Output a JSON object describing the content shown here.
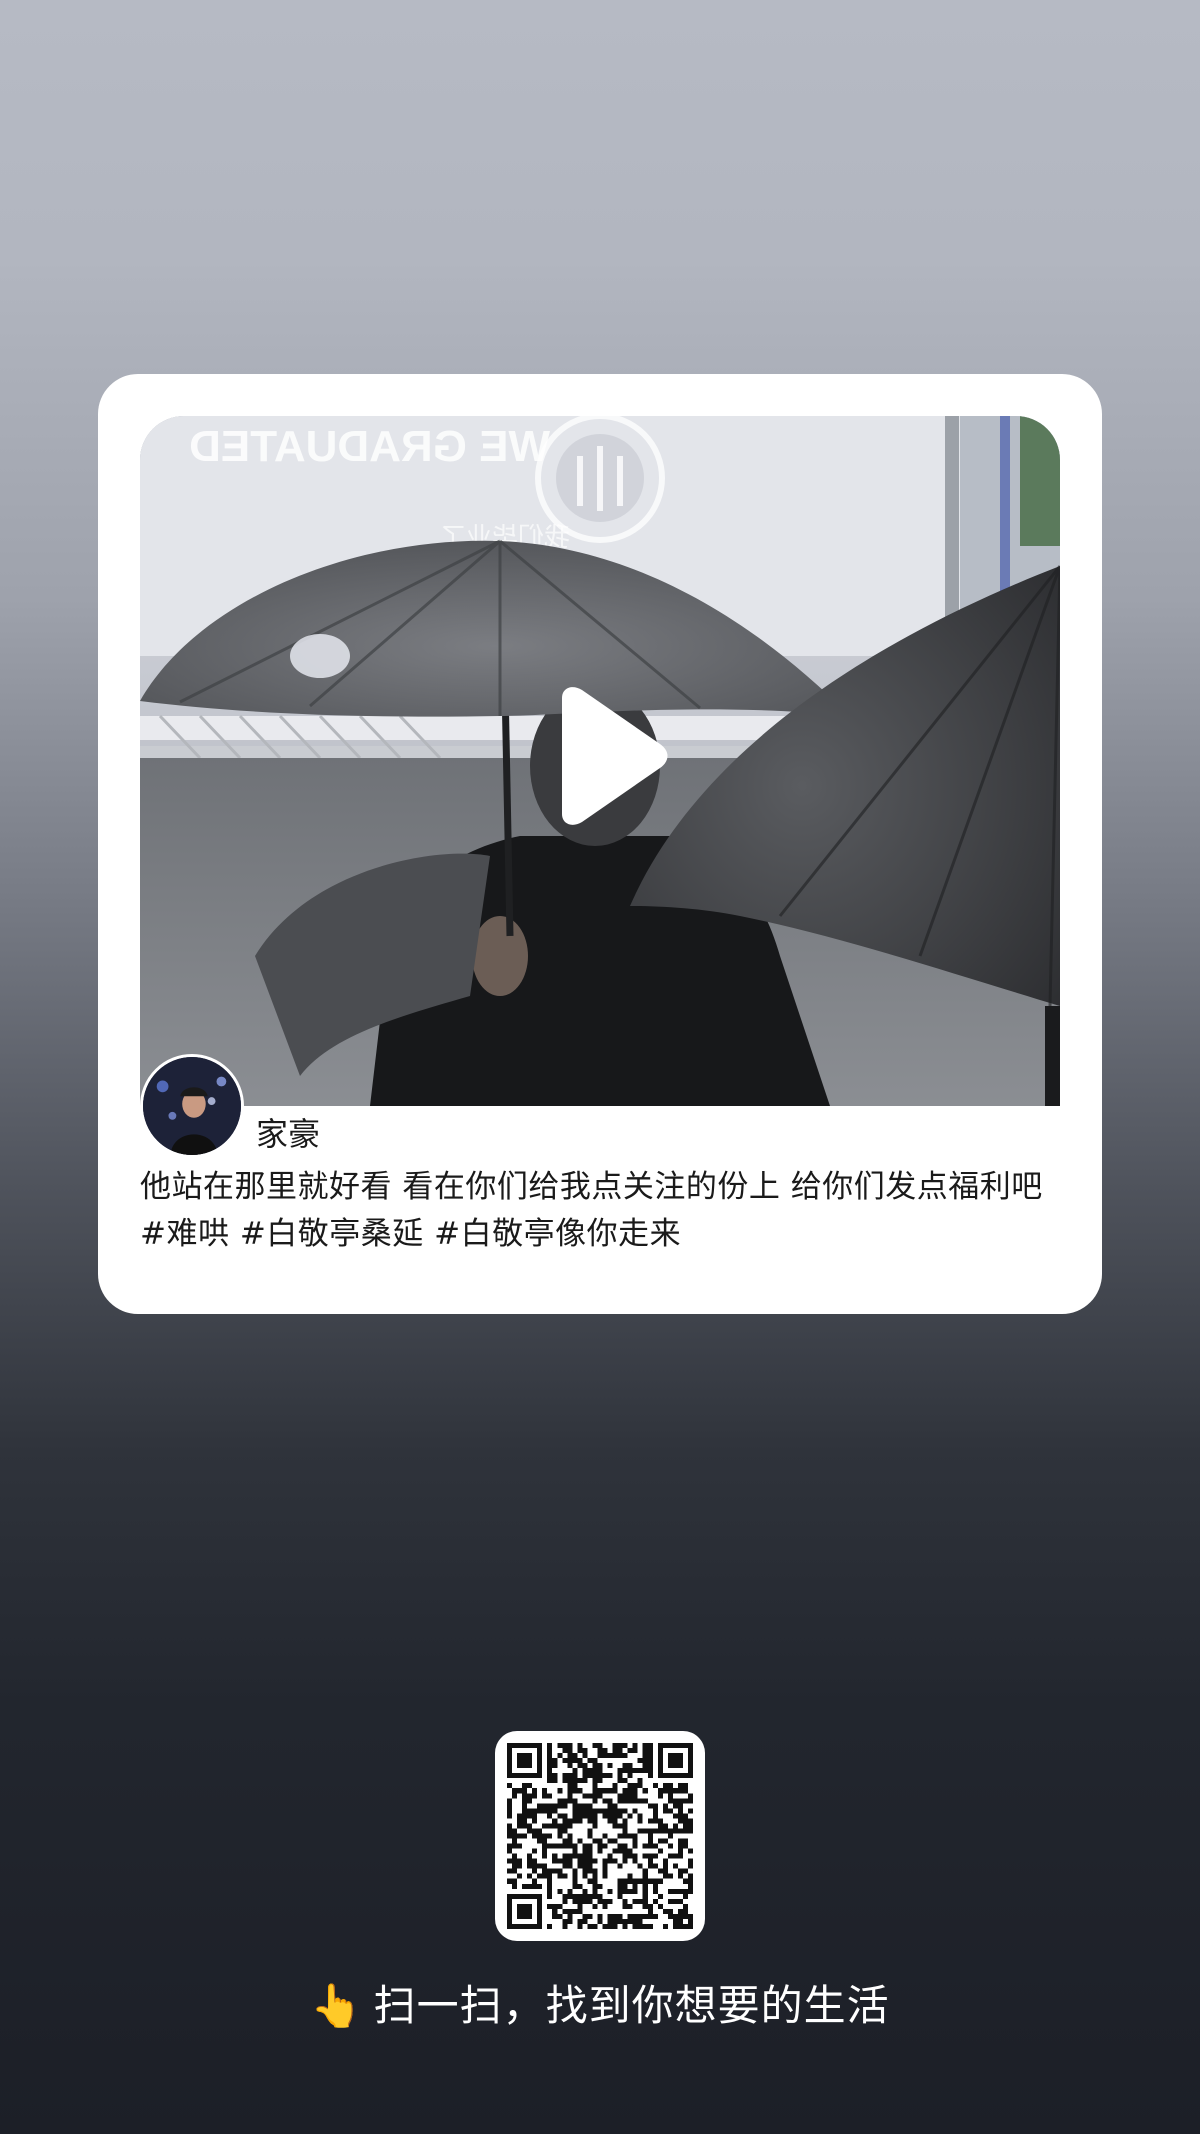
{
  "post": {
    "author_name": "家豪",
    "caption": "他站在那里就好看 看在你们给我点关注的份上 给你们发点福利吧#难哄 #白敬亭桑延 #白敬亭像你走来",
    "video_overlay_text_cn": "我们毕业了",
    "video_overlay_text_en": "WE GRADUATED"
  },
  "footer": {
    "hand_icon": "👆",
    "slogan": "扫一扫，找到你想要的生活"
  },
  "colors": {
    "card_background": "#ffffff",
    "text_primary": "#1a1a1a",
    "slogan_text": "#ffffff",
    "play_icon": "#ffffff"
  },
  "icons": {
    "play": "play-icon",
    "qr": "qr-code",
    "pointer": "pointing-up-hand-icon"
  }
}
